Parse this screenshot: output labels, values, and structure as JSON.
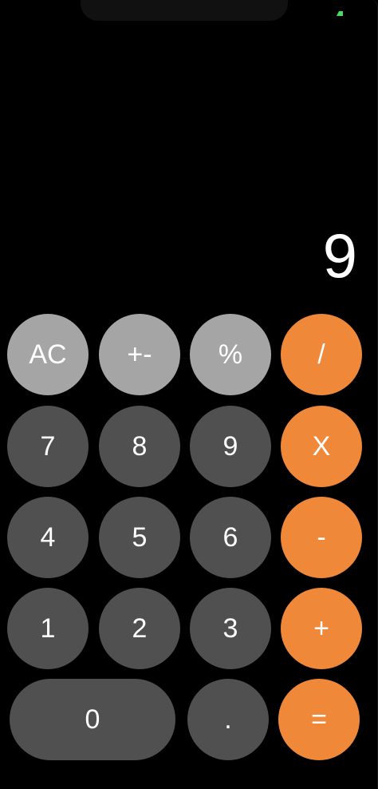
{
  "display": {
    "value": "9"
  },
  "colors": {
    "background": "#000000",
    "function_key": "#a5a5a5",
    "number_key": "#505050",
    "operator_key": "#f0883a",
    "battery": "#4cd964"
  },
  "keys": {
    "ac": "AC",
    "plusminus": "+-",
    "percent": "%",
    "divide": "/",
    "seven": "7",
    "eight": "8",
    "nine": "9",
    "multiply": "X",
    "four": "4",
    "five": "5",
    "six": "6",
    "minus": "-",
    "one": "1",
    "two": "2",
    "three": "3",
    "plus": "+",
    "zero": "0",
    "decimal": ".",
    "equals": "="
  }
}
